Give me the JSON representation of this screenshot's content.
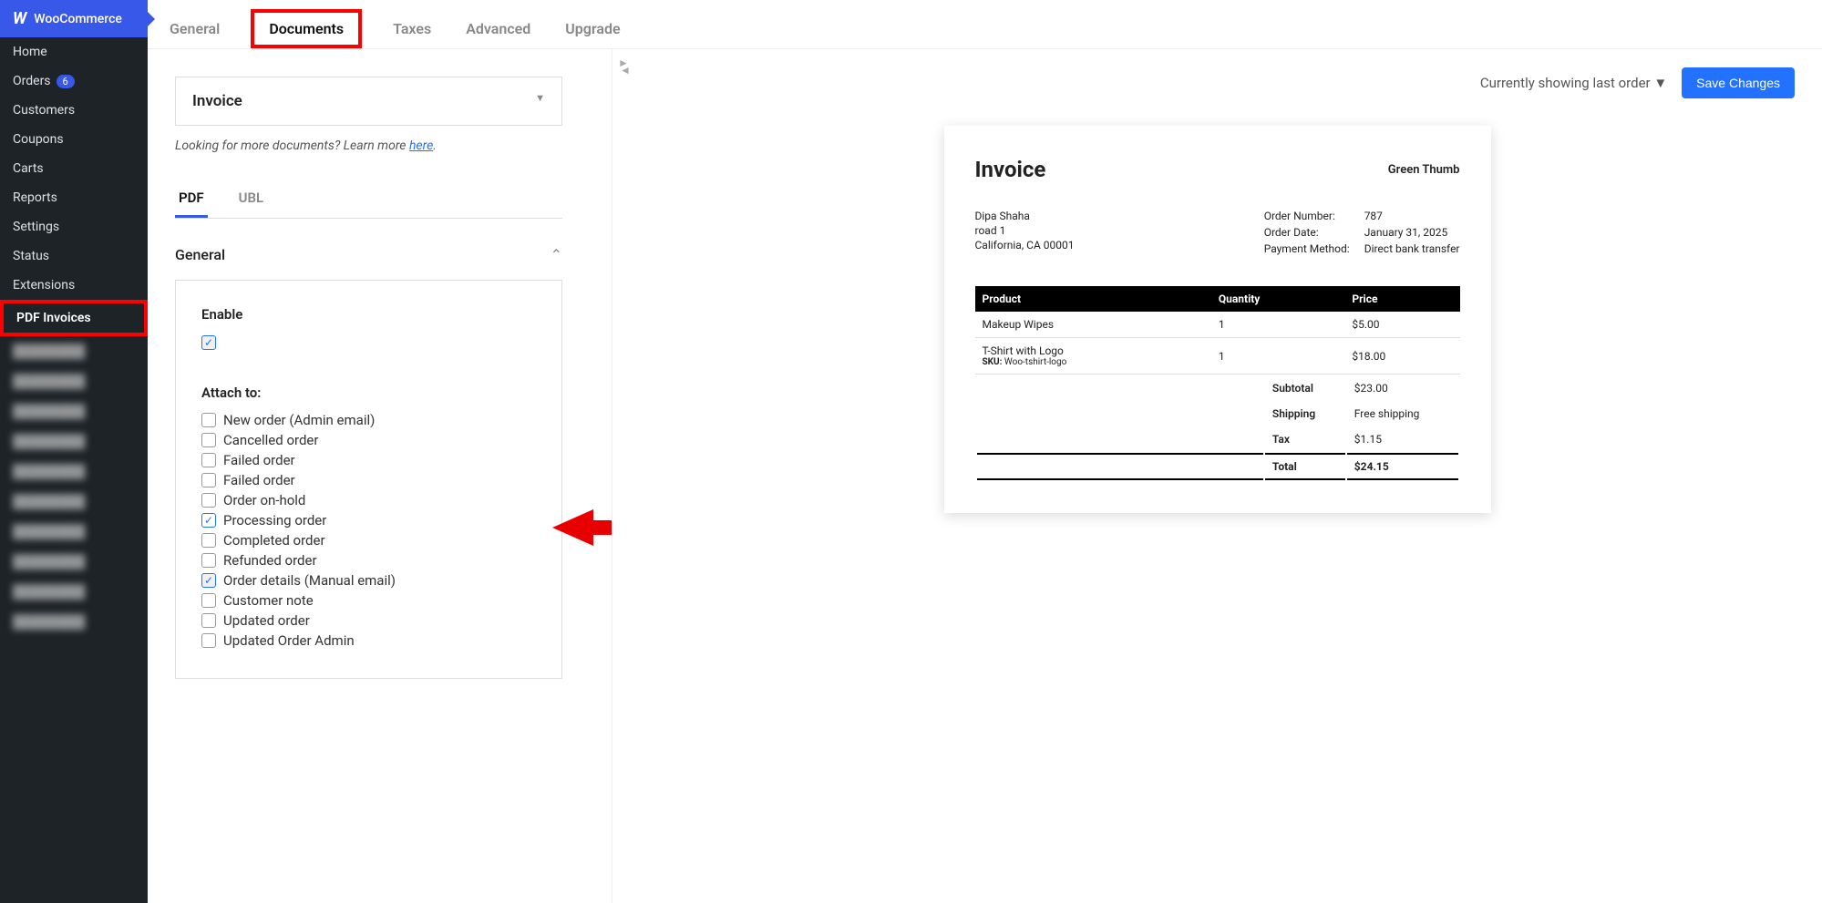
{
  "sidebar": {
    "header": "WooCommerce",
    "items": [
      {
        "label": "Home"
      },
      {
        "label": "Orders",
        "badge": "6"
      },
      {
        "label": "Customers"
      },
      {
        "label": "Coupons"
      },
      {
        "label": "Carts"
      },
      {
        "label": "Reports"
      },
      {
        "label": "Settings"
      },
      {
        "label": "Status"
      },
      {
        "label": "Extensions"
      },
      {
        "label": "PDF Invoices",
        "active": true,
        "highlight": true
      }
    ]
  },
  "tabs": {
    "general": "General",
    "documents": "Documents",
    "taxes": "Taxes",
    "advanced": "Advanced",
    "upgrade": "Upgrade"
  },
  "top": {
    "showing": "Currently showing last order  ▼",
    "save": "Save Changes"
  },
  "doc_select": "Invoice",
  "hint_prefix": "Looking for more documents? Learn more ",
  "hint_link": "here",
  "subtabs": {
    "pdf": "PDF",
    "ubl": "UBL"
  },
  "section": "General",
  "enable_label": "Enable",
  "attach_label": "Attach to:",
  "attach_options": [
    {
      "label": "New order (Admin email)",
      "checked": false
    },
    {
      "label": "Cancelled order",
      "checked": false
    },
    {
      "label": "Failed order",
      "checked": false
    },
    {
      "label": "Failed order",
      "checked": false
    },
    {
      "label": "Order on-hold",
      "checked": false
    },
    {
      "label": "Processing order",
      "checked": true,
      "arrow": true
    },
    {
      "label": "Completed order",
      "checked": false
    },
    {
      "label": "Refunded order",
      "checked": false
    },
    {
      "label": "Order details (Manual email)",
      "checked": true,
      "gray": true
    },
    {
      "label": "Customer note",
      "checked": false
    },
    {
      "label": "Updated order",
      "checked": false
    },
    {
      "label": "Updated Order Admin",
      "checked": false
    }
  ],
  "invoice": {
    "title": "Invoice",
    "brand": "Green Thumb",
    "bill_to": [
      "Dipa Shaha",
      "road 1",
      "California, CA 00001"
    ],
    "meta": [
      {
        "k": "Order Number:",
        "v": "787"
      },
      {
        "k": "Order Date:",
        "v": "January 31, 2025"
      },
      {
        "k": "Payment Method:",
        "v": "Direct bank transfer"
      }
    ],
    "th": {
      "product": "Product",
      "qty": "Quantity",
      "price": "Price"
    },
    "lines": [
      {
        "product": "Makeup Wipes",
        "qty": "1",
        "price": "$5.00"
      },
      {
        "product": "T-Shirt with Logo",
        "sku_label": "SKU:",
        "sku": "Woo-tshirt-logo",
        "qty": "1",
        "price": "$18.00"
      }
    ],
    "totals": [
      {
        "k": "Subtotal",
        "v": "$23.00"
      },
      {
        "k": "Shipping",
        "v": "Free shipping"
      },
      {
        "k": "Tax",
        "v": "$1.15"
      },
      {
        "k": "Total",
        "v": "$24.15",
        "total": true
      }
    ]
  }
}
